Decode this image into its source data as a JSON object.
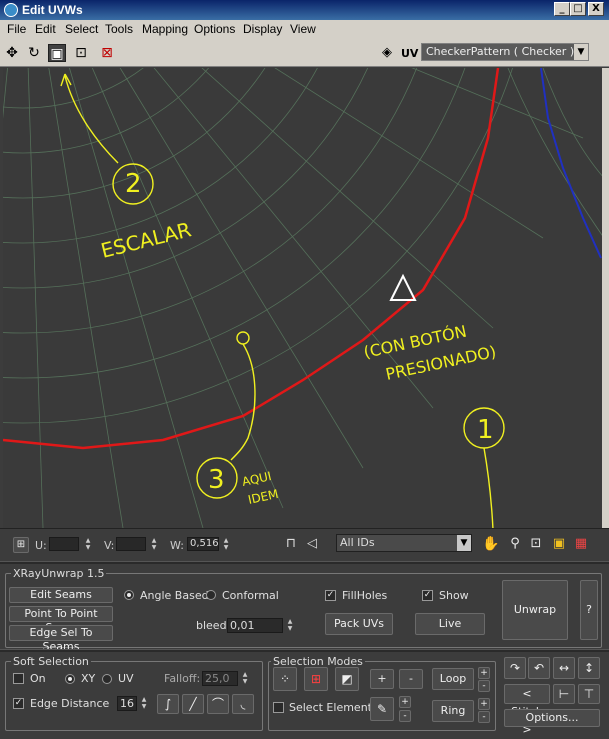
{
  "window": {
    "title": "Edit UVWs",
    "minimize": "_",
    "maximize": "□",
    "close": "X"
  },
  "menu": [
    "File",
    "Edit",
    "Select",
    "Tools",
    "Mapping",
    "Options",
    "Display",
    "View"
  ],
  "toolbar": {
    "icons": [
      "move-icon",
      "rotate-icon",
      "scale-icon",
      "freeform-icon",
      "mirror-icon"
    ],
    "uv_label": "UV",
    "texture_select": "CheckerPattern  ( Checker )"
  },
  "annotations": {
    "step2_number": "2",
    "step2_text": "ESCALAR",
    "note_line1": "(CON BOTÓN",
    "note_line2": "PRESIONADO)",
    "step1_number": "1",
    "step3_number": "3",
    "step3_line1": "AQUI",
    "step3_line2": "IDEM",
    "colors": {
      "annotation": "#f0f020",
      "red_edge": "#e01818",
      "blue_edge": "#2030c0",
      "grid": "#55705a"
    }
  },
  "status": {
    "u_label": "U:",
    "u_value": "",
    "v_label": "V:",
    "v_value": "",
    "w_label": "W:",
    "w_value": "0,516",
    "ids_select": "All IDs"
  },
  "xray": {
    "title": "XRayUnwrap 1.5",
    "edit_seams": "Edit Seams",
    "point_to_point": "Point To Point Seam",
    "edge_sel_to_seams": "Edge Sel To Seams",
    "angle_based": "Angle Based",
    "conformal": "Conformal",
    "fillholes": "FillHoles",
    "show": "Show",
    "bleed_label": "bleed",
    "bleed_value": "0,01",
    "pack_uvs": "Pack UVs",
    "live": "Live",
    "unwrap": "Unwrap",
    "help": "?"
  },
  "soft_selection": {
    "title": "Soft Selection",
    "on": "On",
    "xy": "XY",
    "uv": "UV",
    "falloff_label": "Falloff:",
    "falloff_value": "25,0",
    "edge_distance": "Edge Distance",
    "edge_distance_value": "16"
  },
  "selection_modes": {
    "title": "Selection Modes",
    "select_element": "Select Element",
    "plus": "+",
    "minus": "-",
    "loop": "Loop",
    "ring": "Ring",
    "stitch": "Stitch",
    "options": "Options..."
  }
}
